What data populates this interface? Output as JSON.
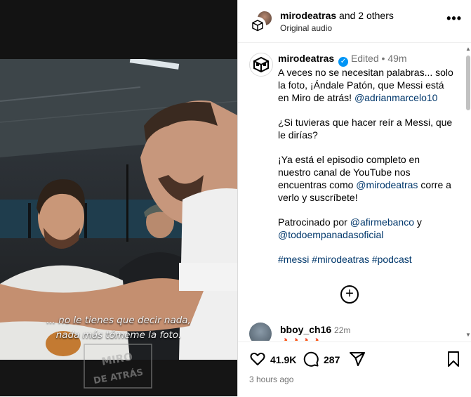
{
  "video": {
    "subtitle_line1": "... no le tienes que decir nada,",
    "subtitle_line2": "nada más tómeme la foto.",
    "watermark": "MIRO DE ATRÁS"
  },
  "header": {
    "username": "mirodeatras",
    "others": "and 2 others",
    "audio": "Original audio",
    "more_icon": "more-horizontal-icon"
  },
  "caption": {
    "username": "mirodeatras",
    "edited": "Edited",
    "dot": "•",
    "time": "49m",
    "p1_text": "A veces no se necesitan palabras... solo la foto, ¡Ándale Patón, que Messi está en Miro de atrás! ",
    "p1_mention": "@adrianmarcelo10",
    "p2_text": "¿Si tuvieras que hacer reír a Messi, que le dirías?",
    "p3_text": "¡Ya está el episodio completo en nuestro canal de YouTube nos encuentras como ",
    "p3_mention": "@mirodeatras",
    "p3_text2": " corre a verlo y suscríbete!",
    "p4_text": "Patrocinado por ",
    "p4_mention1": "@afirmebanco",
    "p4_and": " y ",
    "p4_mention2": "@todoempanadasoficial",
    "hashtags": "#messi #mirodeatras #podcast"
  },
  "comment": {
    "username": "bboy_ch16",
    "time": "22m",
    "emoji": "🔥🔥🔥🔥"
  },
  "actions": {
    "likes": "41.9K",
    "comments": "287",
    "posted_ago": "3 hours ago"
  },
  "colors": {
    "link": "#00376b",
    "verified": "#0095f6",
    "muted": "#737373"
  }
}
